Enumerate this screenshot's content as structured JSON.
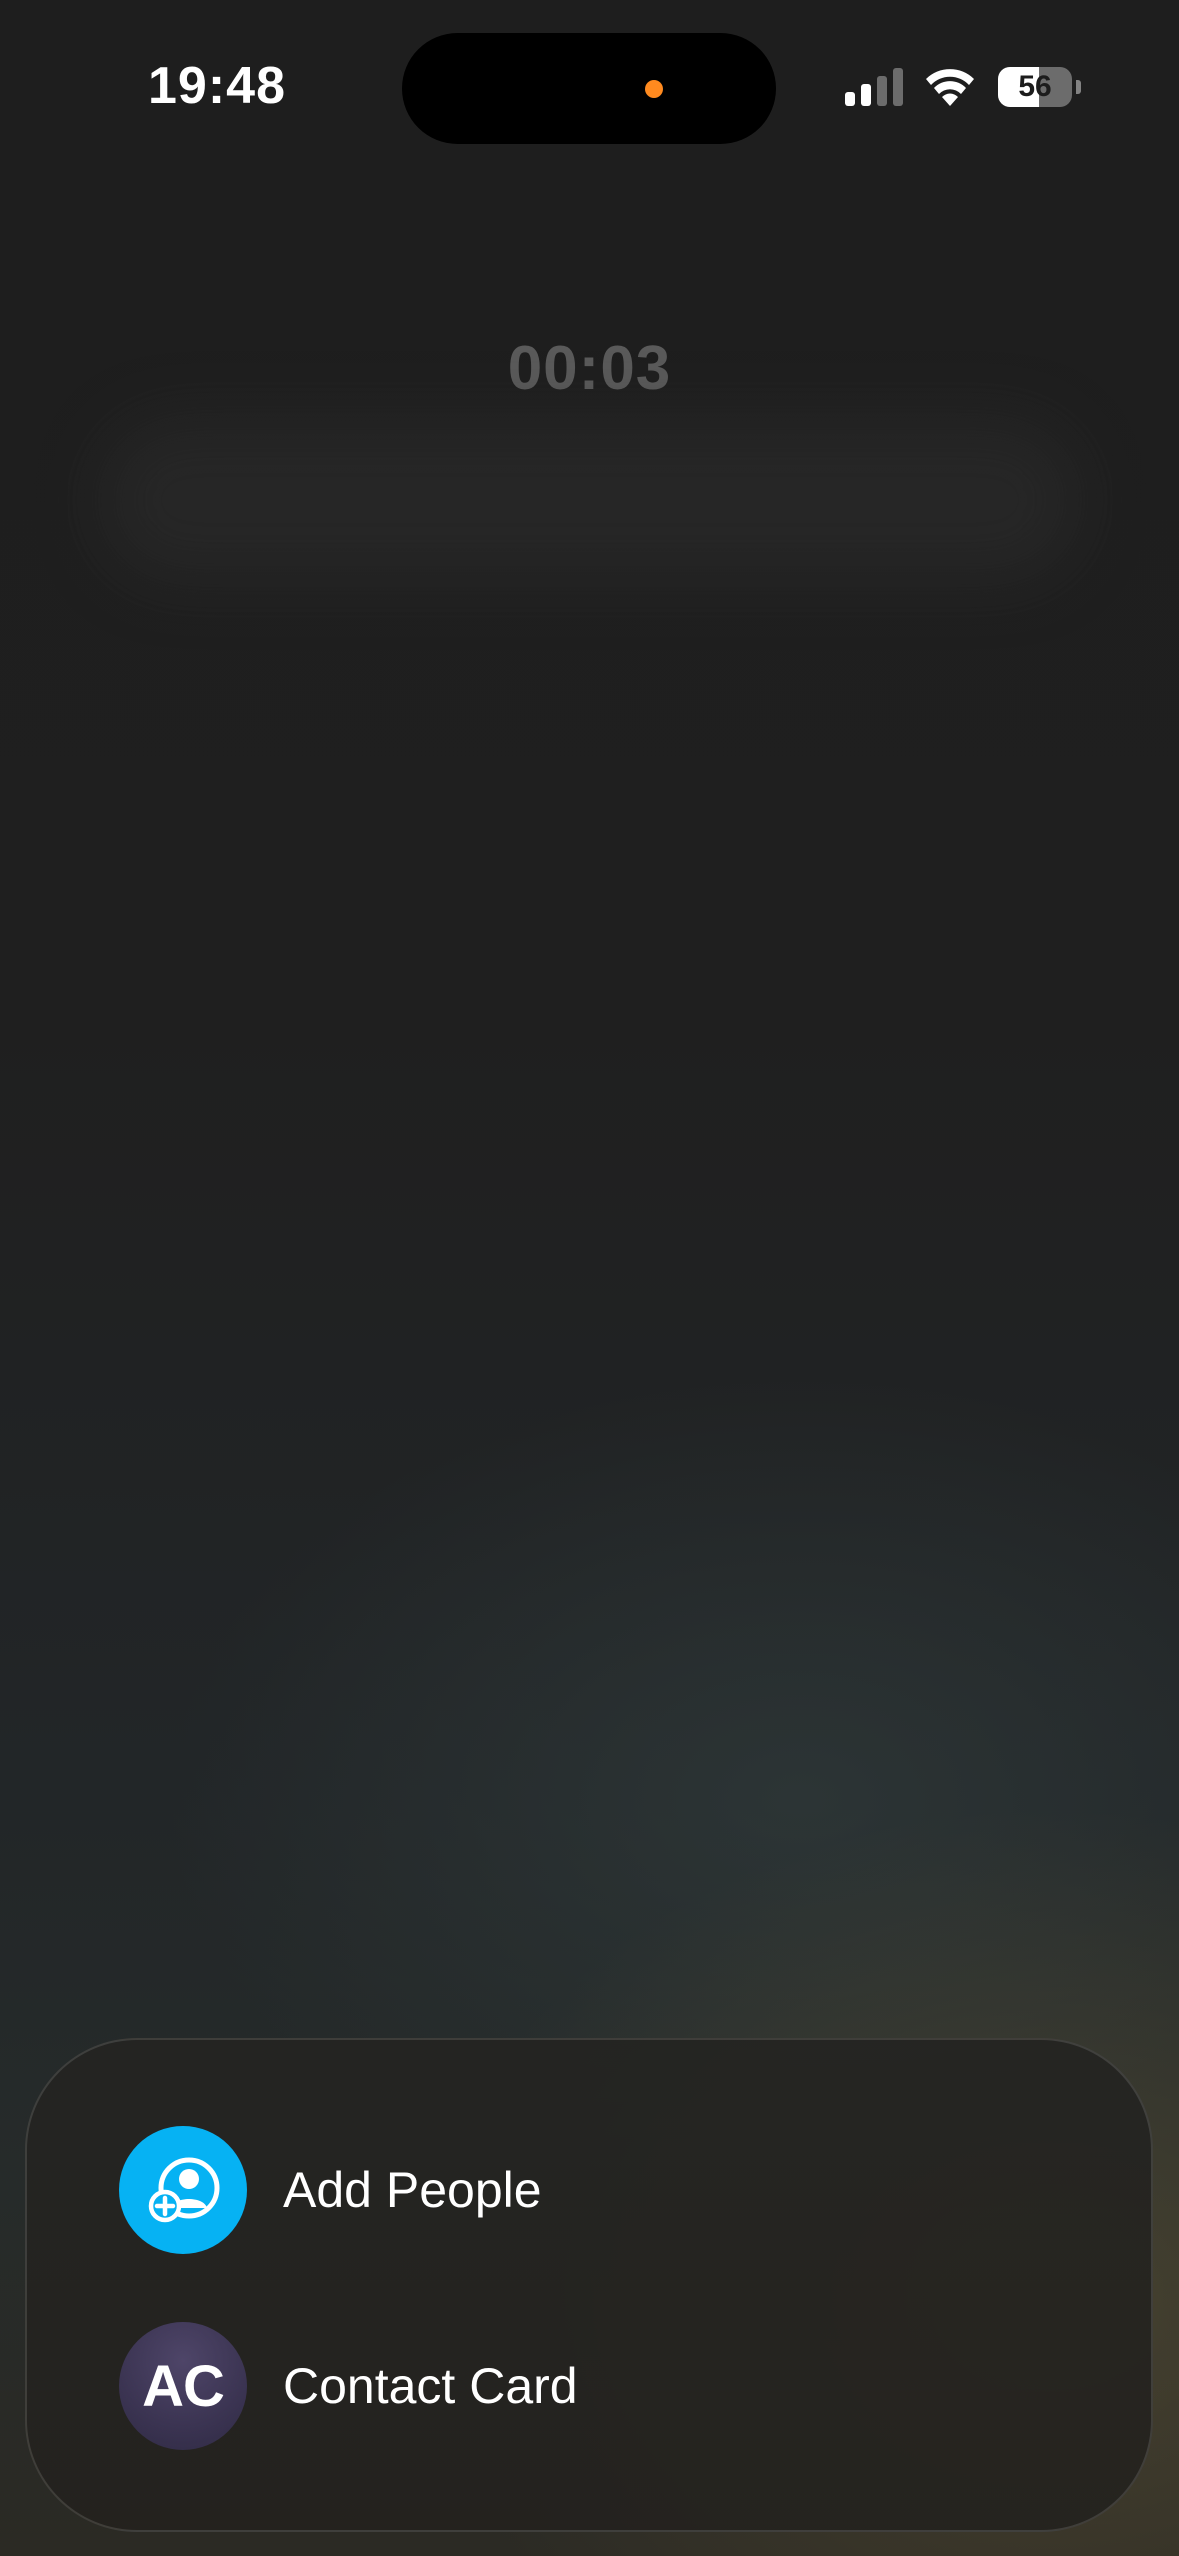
{
  "status_bar": {
    "time": "19:48",
    "battery_percent": "56",
    "battery_level": 0.56,
    "signal_bars_active": 2,
    "signal_bars_total": 4,
    "indicator_color": "#ff8a1f"
  },
  "call": {
    "timer": "00:03"
  },
  "menu": {
    "items": [
      {
        "label": "Add People",
        "icon": "add-person-icon",
        "icon_color": "#06b2f3"
      },
      {
        "label": "Contact Card",
        "avatar_initials": "AC",
        "avatar_color": "#3b3452"
      }
    ]
  }
}
